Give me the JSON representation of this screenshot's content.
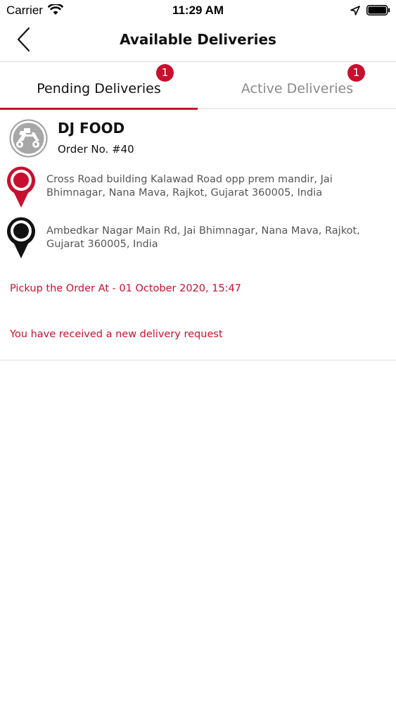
{
  "status_bar": {
    "carrier": "Carrier",
    "time": "11:29 AM"
  },
  "header": {
    "title": "Available Deliveries"
  },
  "tabs": [
    {
      "label": "Pending Deliveries",
      "badge": "1",
      "selected": true
    },
    {
      "label": "Active Deliveries",
      "badge": "1",
      "selected": false
    }
  ],
  "delivery": {
    "store_name": "DJ FOOD",
    "order_number": "Order No. #40",
    "pickup_address": "Cross Road building Kalawad Road opp prem mandir, Jai Bhimnagar, Nana Mava, Rajkot, Gujarat 360005, India",
    "drop_address": "Ambedkar Nagar Main Rd, Jai Bhimnagar, Nana Mava, Rajkot, Gujarat 360005, India",
    "pickup_time": "Pickup the Order At - 01 October 2020, 15:47",
    "notice": "You have received a new delivery request"
  },
  "colors": {
    "accent": "#c8102e",
    "pin_pickup": "#c8102e",
    "pin_drop": "#111111",
    "inactive_tab": "#8a8a8a"
  },
  "icons": [
    "wifi-icon",
    "location-arrow-icon",
    "battery-icon",
    "back-chevron-icon",
    "scooter-avatar-icon",
    "pickup-pin-icon",
    "drop-pin-icon"
  ]
}
